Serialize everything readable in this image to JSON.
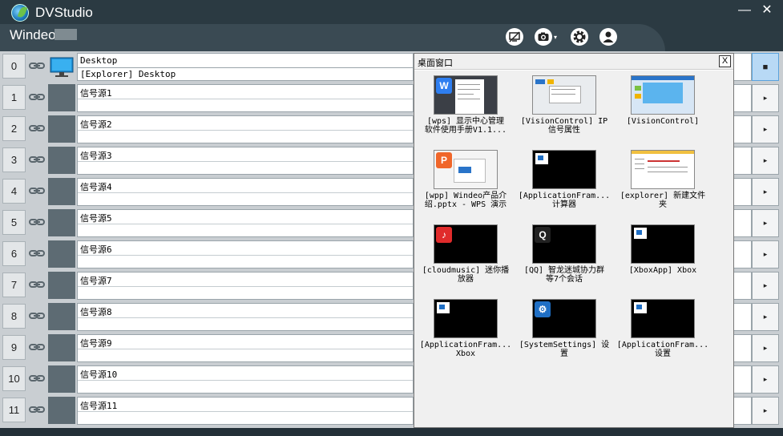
{
  "window": {
    "title": "DVStudio",
    "minimize": "—",
    "close": "✕"
  },
  "header": {
    "brand": "Windeo",
    "icons": [
      "display-off-icon",
      "camera-icon",
      "settings-icon",
      "user-icon"
    ]
  },
  "rows": [
    {
      "num": "0",
      "line1": "Desktop",
      "line2": "[Explorer] Desktop",
      "arrow": "■"
    },
    {
      "num": "1",
      "line1": "信号源1",
      "line2": "",
      "arrow": "▸"
    },
    {
      "num": "2",
      "line1": "信号源2",
      "line2": "",
      "arrow": "▸"
    },
    {
      "num": "3",
      "line1": "信号源3",
      "line2": "",
      "arrow": "▸"
    },
    {
      "num": "4",
      "line1": "信号源4",
      "line2": "",
      "arrow": "▸"
    },
    {
      "num": "5",
      "line1": "信号源5",
      "line2": "",
      "arrow": "▸"
    },
    {
      "num": "6",
      "line1": "信号源6",
      "line2": "",
      "arrow": "▸"
    },
    {
      "num": "7",
      "line1": "信号源7",
      "line2": "",
      "arrow": "▸"
    },
    {
      "num": "8",
      "line1": "信号源8",
      "line2": "",
      "arrow": "▸"
    },
    {
      "num": "9",
      "line1": "信号源9",
      "line2": "",
      "arrow": "▸"
    },
    {
      "num": "10",
      "line1": "信号源10",
      "line2": "",
      "arrow": "▸"
    },
    {
      "num": "11",
      "line1": "信号源11",
      "line2": "",
      "arrow": "▸"
    }
  ],
  "popup": {
    "title": "桌面窗口",
    "close": "X",
    "tiles": [
      {
        "l1": "[wps] 显示中心管理",
        "l2": "软件使用手册V1.1...",
        "icon": "W",
        "icon_color": "#2e7ef0",
        "style": "doc"
      },
      {
        "l1": "[VisionControl] IP",
        "l2": "信号属性",
        "icon": "",
        "icon_color": "",
        "style": "dialog"
      },
      {
        "l1": "[VisionControl]",
        "l2": "",
        "icon": "",
        "icon_color": "",
        "style": "app"
      },
      {
        "l1": "[wpp] Windeo产品介",
        "l2": "绍.pptx - WPS 演示",
        "icon": "P",
        "icon_color": "#f0662a",
        "style": "ppt"
      },
      {
        "l1": "[ApplicationFram...",
        "l2": "计算器",
        "icon": "win",
        "icon_color": "",
        "style": "black"
      },
      {
        "l1": "[explorer] 新建文件",
        "l2": "夹",
        "icon": "",
        "icon_color": "",
        "style": "explorer"
      },
      {
        "l1": "[cloudmusic] 迷你播",
        "l2": "放器",
        "icon": "♪",
        "icon_color": "#e02b2b",
        "style": "black"
      },
      {
        "l1": "[QQ] 智龙迷城协力群",
        "l2": "等7个会话",
        "icon": "Q",
        "icon_color": "#222",
        "style": "black"
      },
      {
        "l1": "[XboxApp] Xbox",
        "l2": "",
        "icon": "win",
        "icon_color": "",
        "style": "black"
      },
      {
        "l1": "[ApplicationFram...",
        "l2": "Xbox",
        "icon": "win",
        "icon_color": "",
        "style": "black"
      },
      {
        "l1": "[SystemSettings] 设",
        "l2": "置",
        "icon": "⚙",
        "icon_color": "#1f6fc5",
        "style": "black"
      },
      {
        "l1": "[ApplicationFram...",
        "l2": "设置",
        "icon": "win",
        "icon_color": "",
        "style": "black"
      }
    ]
  }
}
